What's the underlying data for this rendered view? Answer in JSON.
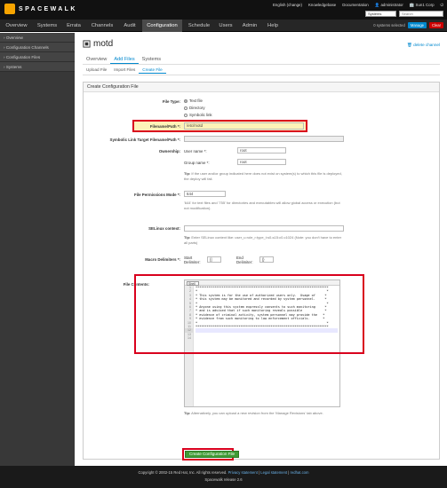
{
  "header": {
    "logo_text": "SPACEWALK",
    "links": [
      "English (change)",
      "Knowledgebase",
      "Documentation",
      "administrator",
      "Sun1 Corp"
    ],
    "search_select": "Systems",
    "search_placeholder": "Search"
  },
  "nav": {
    "items": [
      "Overview",
      "Systems",
      "Errata",
      "Channels",
      "Audit",
      "Configuration",
      "Schedule",
      "Users",
      "Admin",
      "Help"
    ],
    "active": "Configuration",
    "systems_selected": "0 systems selected",
    "manage_label": "Manage",
    "clear_label": "Clear"
  },
  "sidebar": {
    "items": [
      "Overview",
      "Configuration Channels",
      "Configuration Files",
      "Systems"
    ]
  },
  "page": {
    "title": "motd",
    "delete_link": "delete channel",
    "tabs": [
      "Overview",
      "Add Files",
      "Systems"
    ],
    "active_tab": "Add Files",
    "subtabs": [
      "Upload File",
      "Import Files",
      "Create File"
    ],
    "active_subtab": "Create File"
  },
  "form": {
    "panel_title": "Create Configuration File",
    "file_type_label": "File Type:",
    "file_type_options": [
      "Text file",
      "Directory",
      "Symbolic link"
    ],
    "file_type_selected": "Text file",
    "filename_label": "Filename/Path *:",
    "filename_value": "/etc/motd",
    "symlink_label": "Symbolic Link Target Filename/Path *:",
    "symlink_value": "",
    "ownership_label": "Ownership:",
    "user_name_label": "User name *:",
    "user_name_value": "root",
    "group_name_label": "Group name *:",
    "group_name_value": "root",
    "ownership_tip_prefix": "Tip:",
    "ownership_tip": "If the user and/or group indicated here does not exist on system(s) to which this file is deployed, the deploy will fail.",
    "permissions_label": "File Permissions Mode *:",
    "permissions_value": "644",
    "permissions_tip": "'644' for text files and '755' for directories and executables will allow global access or execution (but not modification).",
    "selinux_label": "SELinux context:",
    "selinux_value": "",
    "selinux_tip_prefix": "Tip:",
    "selinux_tip": "Enter SELinux context like: user_u:role_r:type_t:s0-s15:c0.c1024 (Note: you don't have to enter all parts)",
    "macro_label": "Macro Delimiters *:",
    "macro_start_label": "Start Delimiter:",
    "macro_start_value": "{|",
    "macro_end_label": "End Delimiter:",
    "macro_end_value": "|}",
    "contents_label": "File Contents:",
    "editor_mode": "Shell",
    "editor_lines": [
      "***********************************************************************",
      "*                                                                     *",
      "* This system is for the use of authorized users only.  Usage of     *",
      "* this system may be monitored and recorded by system personnel.     *",
      "*                                                                     *",
      "* Anyone using this system expressly consents to such monitoring     *",
      "* and is advised that if such monitoring reveals possible            *",
      "* evidence of criminal activity, system personnel may provide the   *",
      "* evidence from such monitoring to law enforcement officials.       *",
      "*                                                                     *",
      "***********************************************************************",
      "",
      "",
      ""
    ],
    "editor_line_numbers": [
      "1",
      "2",
      "3",
      "4",
      "5",
      "6",
      "7",
      "8",
      "9",
      "10",
      "11",
      "12",
      "13",
      "14"
    ],
    "contents_tip_prefix": "Tip:",
    "contents_tip": "Alternatively, you can upload a new revision from the 'Manage Revisions' tab above.",
    "submit_label": "Create Configuration File"
  },
  "footer": {
    "copyright": "Copyright © 2002-15 Red Hat, Inc. All rights reserved.",
    "links": [
      "Privacy statement",
      "Legal statement",
      "redhat.com"
    ],
    "release": "Spacewalk release 2.6"
  },
  "colors": {
    "accent": "#0088ce",
    "highlight_border": "#d9001d",
    "submit_button": "#3f9c35"
  }
}
